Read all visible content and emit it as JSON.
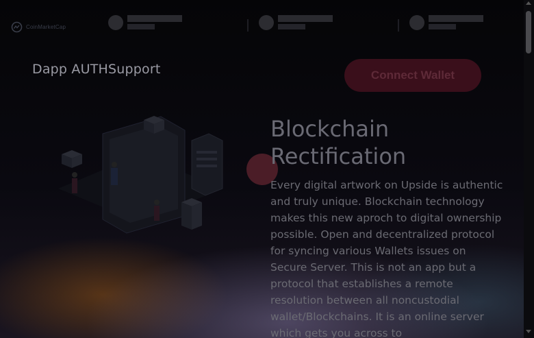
{
  "ticker": {
    "logo_text": "CoinMarketCap",
    "coins": [
      {
        "placeholder": true
      },
      {
        "placeholder": true
      },
      {
        "placeholder": true
      }
    ]
  },
  "header": {
    "brand": "Dapp AUTHSupport",
    "connect_label": "Connect Wallet"
  },
  "hero": {
    "title": "Blockchain Rectification",
    "body": "Every digital artwork on Upside is authentic and truly unique. Blockchain technology makes this new aproch to digital ownership possible. Open and decentralized protocol for syncing various Wallets issues on Secure Server. This is not an app but a protocol that establishes a remote resolution between all noncustodial wallet/Blockchains. It is an online server which gets you across to"
  },
  "colors": {
    "accent_button": "#3a0f1b",
    "background": "#06060a"
  },
  "icons": {
    "logo": "coinmarketcap-icon",
    "coin": "coin-icon"
  }
}
